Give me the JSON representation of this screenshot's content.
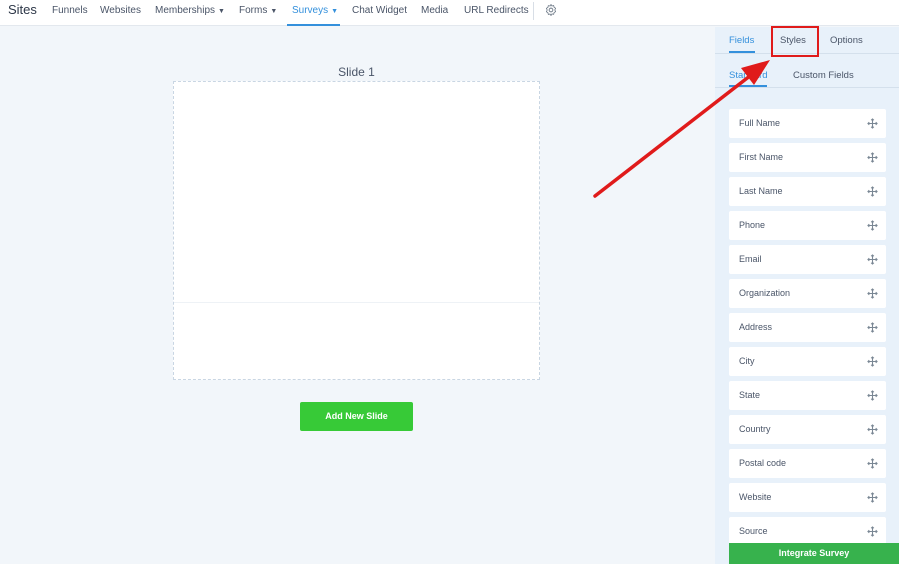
{
  "nav": {
    "brand": "Sites",
    "items": [
      {
        "label": "Funnels"
      },
      {
        "label": "Websites"
      },
      {
        "label": "Memberships"
      },
      {
        "label": "Forms"
      },
      {
        "label": "Surveys"
      },
      {
        "label": "Chat Widget"
      },
      {
        "label": "Media"
      },
      {
        "label": "URL Redirects"
      }
    ],
    "active": "Surveys",
    "settings_icon": "gear-icon"
  },
  "canvas": {
    "slide_title": "Slide 1",
    "add_slide_label": "Add New Slide"
  },
  "panel": {
    "tabs": [
      {
        "label": "Fields"
      },
      {
        "label": "Styles"
      },
      {
        "label": "Options"
      }
    ],
    "active_tab": "Fields",
    "subtabs": [
      {
        "label": "Standard"
      },
      {
        "label": "Custom Fields"
      }
    ],
    "active_subtab": "Standard",
    "fields": [
      {
        "label": "Full Name"
      },
      {
        "label": "First Name"
      },
      {
        "label": "Last Name"
      },
      {
        "label": "Phone"
      },
      {
        "label": "Email"
      },
      {
        "label": "Organization"
      },
      {
        "label": "Address"
      },
      {
        "label": "City"
      },
      {
        "label": "State"
      },
      {
        "label": "Country"
      },
      {
        "label": "Postal code"
      },
      {
        "label": "Website"
      },
      {
        "label": "Source"
      }
    ],
    "integrate_label": "Integrate Survey"
  },
  "colors": {
    "accent": "#3490dc",
    "primary_button": "#37ca37",
    "integrate_button": "#37b24d",
    "annotation": "#e01b1b"
  }
}
